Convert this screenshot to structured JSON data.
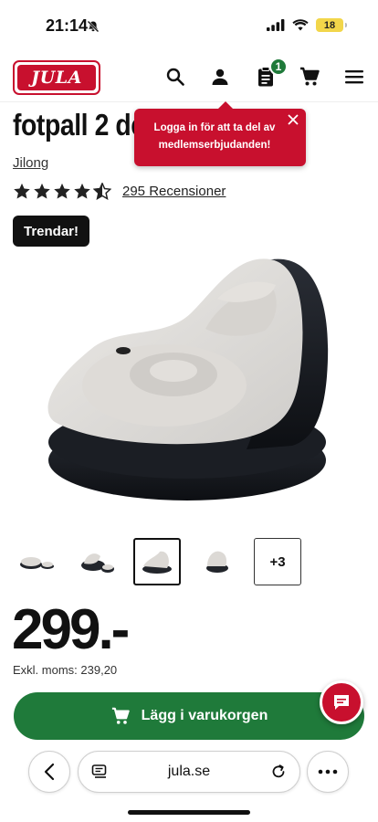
{
  "status_bar": {
    "time": "21:14",
    "battery": "18",
    "icons": [
      "bell-off-icon",
      "signal-icon",
      "wifi-icon",
      "battery-icon"
    ]
  },
  "header": {
    "logo_text": "JULA",
    "cart_badge": "1",
    "icons": [
      "search-icon",
      "user-icon",
      "list-icon",
      "cart-icon",
      "menu-icon"
    ]
  },
  "product": {
    "title": "fotpall 2 delar",
    "brand": "Jilong",
    "rating_stars": 4.5,
    "reviews": "295 Recensioner",
    "badge": "Trendar!",
    "price": "299.-",
    "price_ex_vat": "Exkl. moms: 239,20"
  },
  "login_popup": {
    "text": "Logga in för att ta del av medlemserbjudanden!"
  },
  "thumbnails": {
    "count": 4,
    "more_label": "+3",
    "active_index": 2
  },
  "cart_button": {
    "label": "Lägg i varukorgen"
  },
  "browser": {
    "url": "jula.se"
  },
  "colors": {
    "brand_red": "#c8102e",
    "green": "#1f7a3a",
    "dark": "#111111"
  }
}
